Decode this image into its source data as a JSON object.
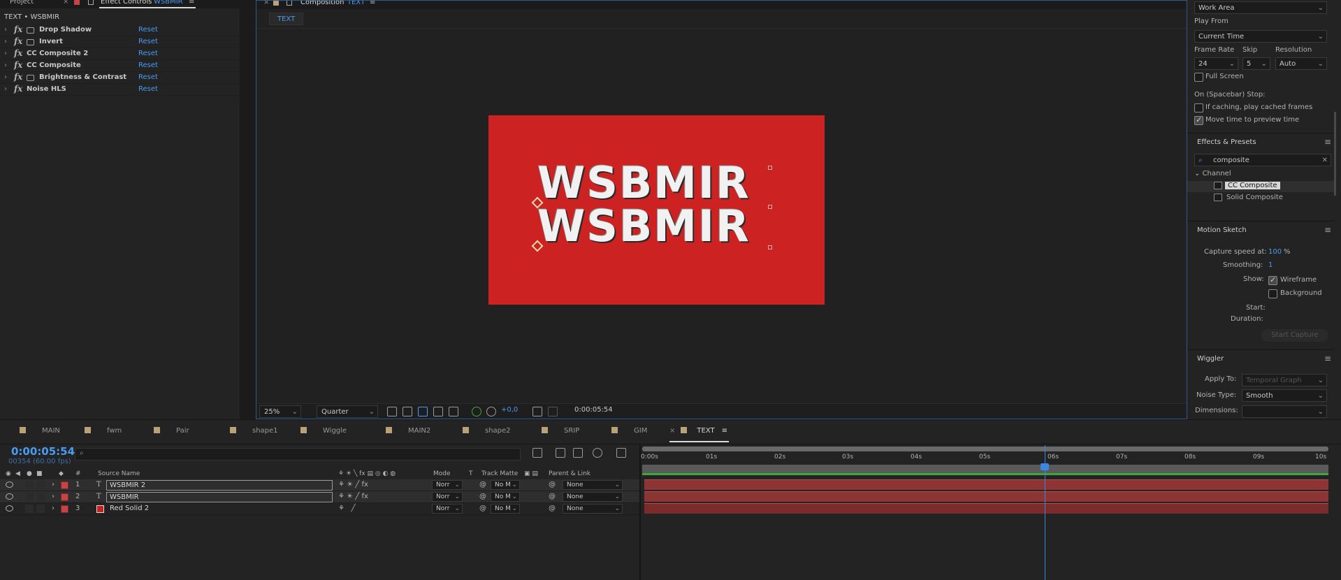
{
  "effect_controls": {
    "tab_project": "Project",
    "tab_label": "Effect Controls",
    "tab_layer": "WSBMIR",
    "title": "TEXT • WSBMIR",
    "effects": [
      {
        "name": "Drop Shadow",
        "reset": "Reset"
      },
      {
        "name": "Invert",
        "reset": "Reset"
      },
      {
        "name": "CC Composite 2",
        "reset": "Reset"
      },
      {
        "name": "CC Composite",
        "reset": "Reset"
      },
      {
        "name": "Brightness & Contrast",
        "reset": "Reset"
      },
      {
        "name": "Noise HLS",
        "reset": "Reset"
      }
    ]
  },
  "composition": {
    "tab_label": "Composition",
    "tab_comp": "TEXT",
    "subtab": "TEXT",
    "canvas_text_1": "WSBMIR",
    "canvas_text_2": "WSBMIR",
    "canvas_color": "#cc2222",
    "zoom": "25%",
    "resolution": "Quarter",
    "exposure": "+0,0",
    "timecode": "0:00:05:54"
  },
  "preview": {
    "range": "Work Area",
    "play_from_label": "Play From",
    "play_from": "Current Time",
    "frame_rate_label": "Frame Rate",
    "skip_label": "Skip",
    "resolution_label": "Resolution",
    "frame_rate": "24",
    "skip": "5",
    "resolution": "Auto",
    "full_screen": "Full Screen",
    "on_stop": "On (Spacebar) Stop:",
    "if_caching": "If caching, play cached frames",
    "move_time": "Move time to preview time"
  },
  "effects_presets": {
    "title": "Effects & Presets",
    "search": "composite",
    "category": "Channel",
    "items": [
      "CC Composite",
      "Solid Composite"
    ]
  },
  "motion_sketch": {
    "title": "Motion Sketch",
    "capture_label": "Capture speed at:",
    "capture_value": "100",
    "capture_unit": "%",
    "smoothing_label": "Smoothing:",
    "smoothing_value": "1",
    "show_label": "Show:",
    "wireframe": "Wireframe",
    "background": "Background",
    "start_label": "Start:",
    "duration_label": "Duration:",
    "start_capture": "Start Capture"
  },
  "wiggler": {
    "title": "Wiggler",
    "apply_to_label": "Apply To:",
    "apply_to": "Temporal Graph",
    "noise_type_label": "Noise Type:",
    "noise_type": "Smooth",
    "dimensions_label": "Dimensions:"
  },
  "timeline": {
    "tabs": [
      "MAIN",
      "fwm",
      "Pair",
      "shape1",
      "Wiggle",
      "MAIN2",
      "shape2",
      "SRIP",
      "GIM",
      "TEXT"
    ],
    "current_time": "0:00:05:54",
    "frame_info": "00354 (60.00 fps)",
    "columns": {
      "num": "#",
      "source_name": "Source Name",
      "mode": "Mode",
      "t": "T",
      "track_matte": "Track Matte",
      "parent": "Parent & Link"
    },
    "layers": [
      {
        "num": "1",
        "type": "T",
        "name": "WSBMIR 2",
        "mode": "Norr",
        "matte": "No M",
        "parent": "None"
      },
      {
        "num": "2",
        "type": "T",
        "name": "WSBMIR",
        "mode": "Norr",
        "matte": "No M",
        "parent": "None"
      },
      {
        "num": "3",
        "type": "",
        "name": "Red Solid 2",
        "mode": "Norr",
        "matte": "No M",
        "parent": "None"
      }
    ],
    "ruler_ticks": [
      "0:00s",
      "01s",
      "02s",
      "03s",
      "04s",
      "05s",
      "06s",
      "07s",
      "08s",
      "09s",
      "10s"
    ],
    "layer_color": "#c84343"
  }
}
